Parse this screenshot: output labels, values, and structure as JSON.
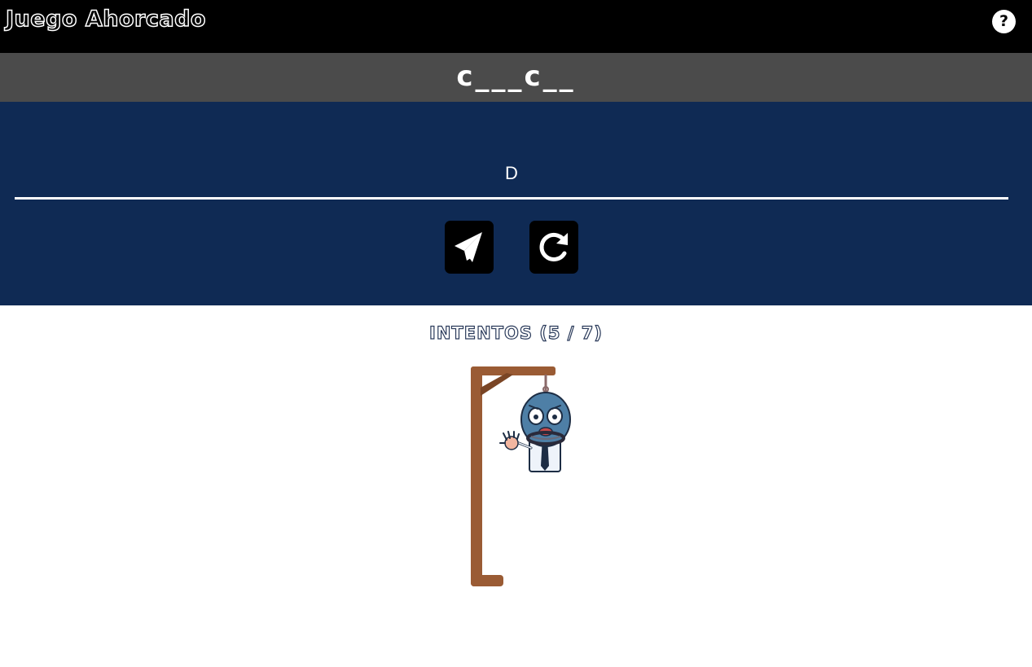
{
  "header": {
    "title": "Juego Ahorcado",
    "help_label": "?"
  },
  "word": {
    "display": "c___c__"
  },
  "input": {
    "value": "D"
  },
  "attempts": {
    "label": "INTENTOS (5 / 7)",
    "used": 5,
    "max": 7
  },
  "icons": {
    "send": "paper-plane-icon",
    "reset": "rotate-right-icon",
    "help": "question-circle-icon"
  },
  "colors": {
    "topbar": "#000000",
    "word_bar": "#4b4b4b",
    "panel": "#0f2a54",
    "gallows": "#9a5b34",
    "character": "#4e7fa6"
  }
}
